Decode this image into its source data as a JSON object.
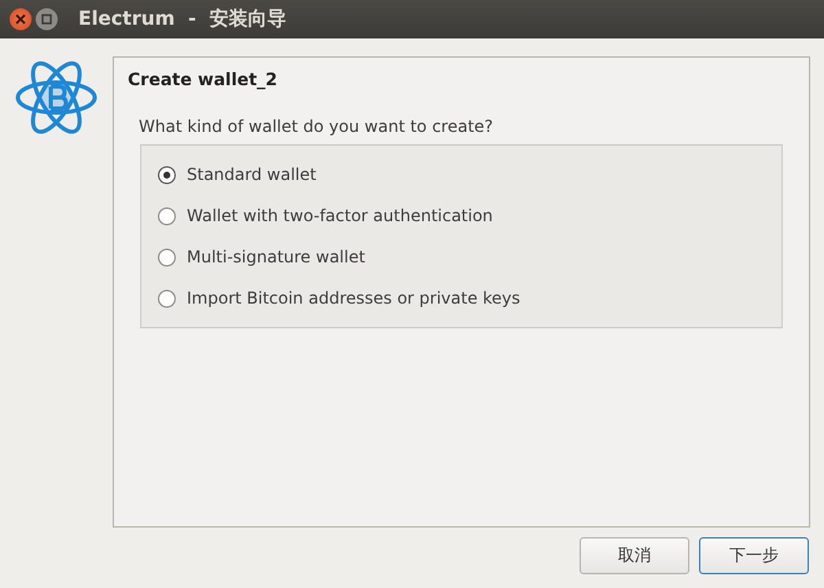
{
  "window": {
    "title": "Electrum  -  安装向导"
  },
  "page": {
    "title": "Create wallet_2",
    "question": "What kind of wallet do you want to create?"
  },
  "options": [
    {
      "label": "Standard wallet",
      "selected": true
    },
    {
      "label": "Wallet with two-factor authentication",
      "selected": false
    },
    {
      "label": "Multi-signature wallet",
      "selected": false
    },
    {
      "label": "Import Bitcoin addresses or private keys",
      "selected": false
    }
  ],
  "buttons": [
    {
      "label": "取消",
      "kind": "secondary"
    },
    {
      "label": "下一步",
      "kind": "default"
    }
  ]
}
